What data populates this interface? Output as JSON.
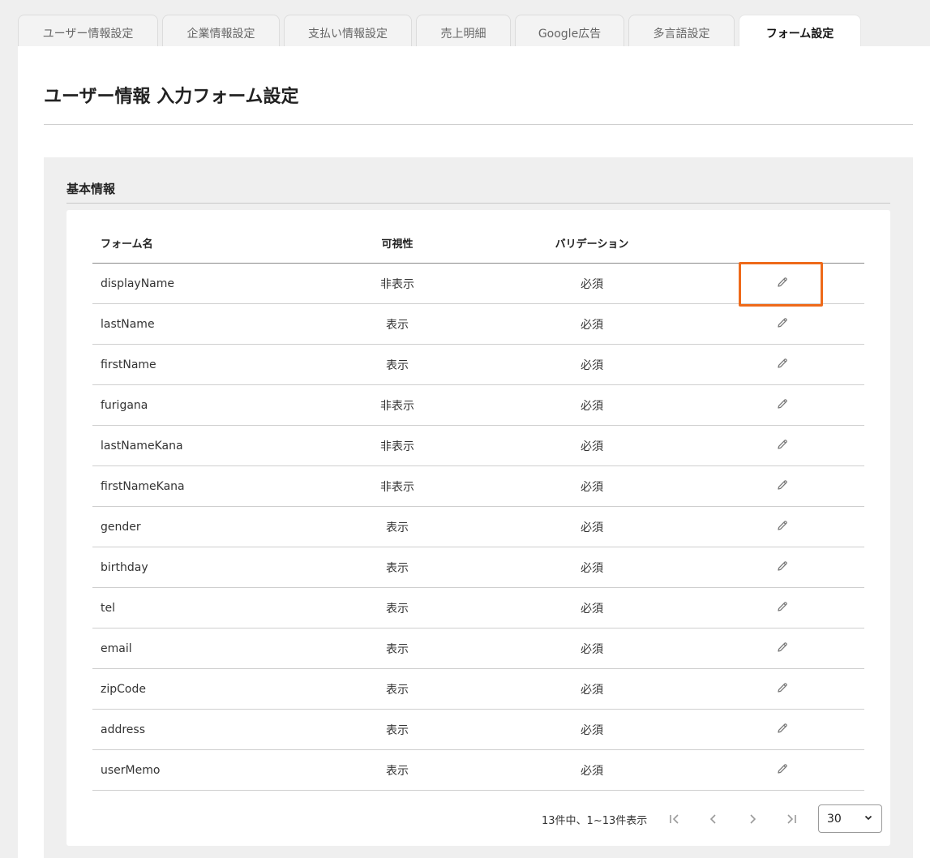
{
  "tabs": [
    {
      "label": "ユーザー情報設定",
      "active": false
    },
    {
      "label": "企業情報設定",
      "active": false
    },
    {
      "label": "支払い情報設定",
      "active": false
    },
    {
      "label": "売上明細",
      "active": false
    },
    {
      "label": "Google広告",
      "active": false
    },
    {
      "label": "多言語設定",
      "active": false
    },
    {
      "label": "フォーム設定",
      "active": true
    }
  ],
  "page": {
    "title": "ユーザー情報 入力フォーム設定"
  },
  "section": {
    "heading": "基本情報"
  },
  "table": {
    "headers": {
      "name": "フォーム名",
      "visibility": "可視性",
      "validation": "バリデーション"
    },
    "edit_icon": "pencil-icon",
    "rows": [
      {
        "name": "displayName",
        "visibility": "非表示",
        "validation": "必須"
      },
      {
        "name": "lastName",
        "visibility": "表示",
        "validation": "必須"
      },
      {
        "name": "firstName",
        "visibility": "表示",
        "validation": "必須"
      },
      {
        "name": "furigana",
        "visibility": "非表示",
        "validation": "必須"
      },
      {
        "name": "lastNameKana",
        "visibility": "非表示",
        "validation": "必須"
      },
      {
        "name": "firstNameKana",
        "visibility": "非表示",
        "validation": "必須"
      },
      {
        "name": "gender",
        "visibility": "表示",
        "validation": "必須"
      },
      {
        "name": "birthday",
        "visibility": "表示",
        "validation": "必須"
      },
      {
        "name": "tel",
        "visibility": "表示",
        "validation": "必須"
      },
      {
        "name": "email",
        "visibility": "表示",
        "validation": "必須"
      },
      {
        "name": "zipCode",
        "visibility": "表示",
        "validation": "必須"
      },
      {
        "name": "address",
        "visibility": "表示",
        "validation": "必須"
      },
      {
        "name": "userMemo",
        "visibility": "表示",
        "validation": "必須"
      }
    ]
  },
  "pagination": {
    "summary": "13件中、1~13件表示",
    "per_page": "30",
    "icons": [
      "first-page-icon",
      "prev-page-icon",
      "next-page-icon",
      "last-page-icon",
      "chevron-down-icon"
    ]
  },
  "colors": {
    "highlight": "#ee6a1a",
    "background": "#efefef",
    "card": "#ffffff"
  }
}
